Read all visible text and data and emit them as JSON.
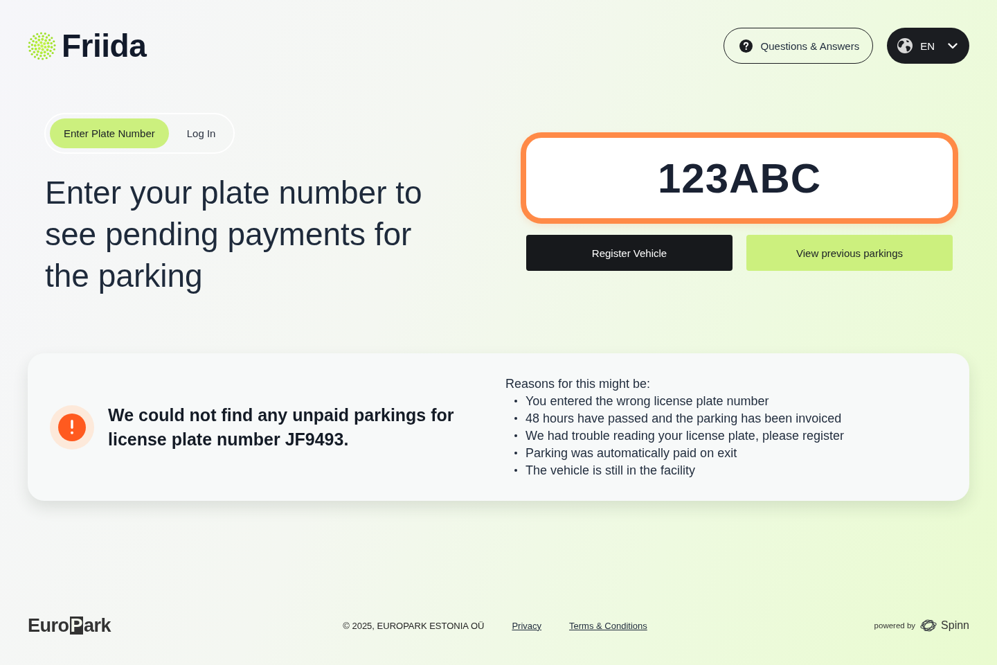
{
  "header": {
    "logo": {
      "name": "Friida"
    },
    "help_button": {
      "label": "Questions & Answers"
    },
    "language_button": {
      "label": "EN"
    }
  },
  "tabs": [
    {
      "label": "Enter Plate Number",
      "selected": true
    },
    {
      "label": "Log In",
      "selected": false
    }
  ],
  "heading": "Enter your plate number to see pending payments for the parking",
  "plate_field": {
    "value": "123ABC",
    "focused": true
  },
  "buttons": [
    {
      "label": "Register Vehicle",
      "kind": "primary"
    },
    {
      "label": "View previous parkings",
      "kind": "secondary"
    }
  ],
  "alert": {
    "kind": "error",
    "message": "We could not find any unpaid parkings for license plate number JF9493.",
    "reasons_title": "Reasons for this might be:",
    "reasons": [
      "You entered the wrong license plate number",
      "48 hours have passed and the parking has been invoiced",
      "We had trouble reading your license plate, please register",
      "Parking was automatically paid on exit",
      "The vehicle is still in the facility"
    ]
  },
  "footer": {
    "brand": [
      {
        "text": "Euro",
        "boxed": false
      },
      {
        "text": "P",
        "boxed": true
      },
      {
        "text": "ark",
        "boxed": false
      }
    ],
    "copyright": "© 2025, EUROPARK ESTONIA OÜ",
    "links": [
      "Privacy",
      "Terms & Conditions"
    ],
    "powered_by": "powered by",
    "partner": "Spinn"
  }
}
